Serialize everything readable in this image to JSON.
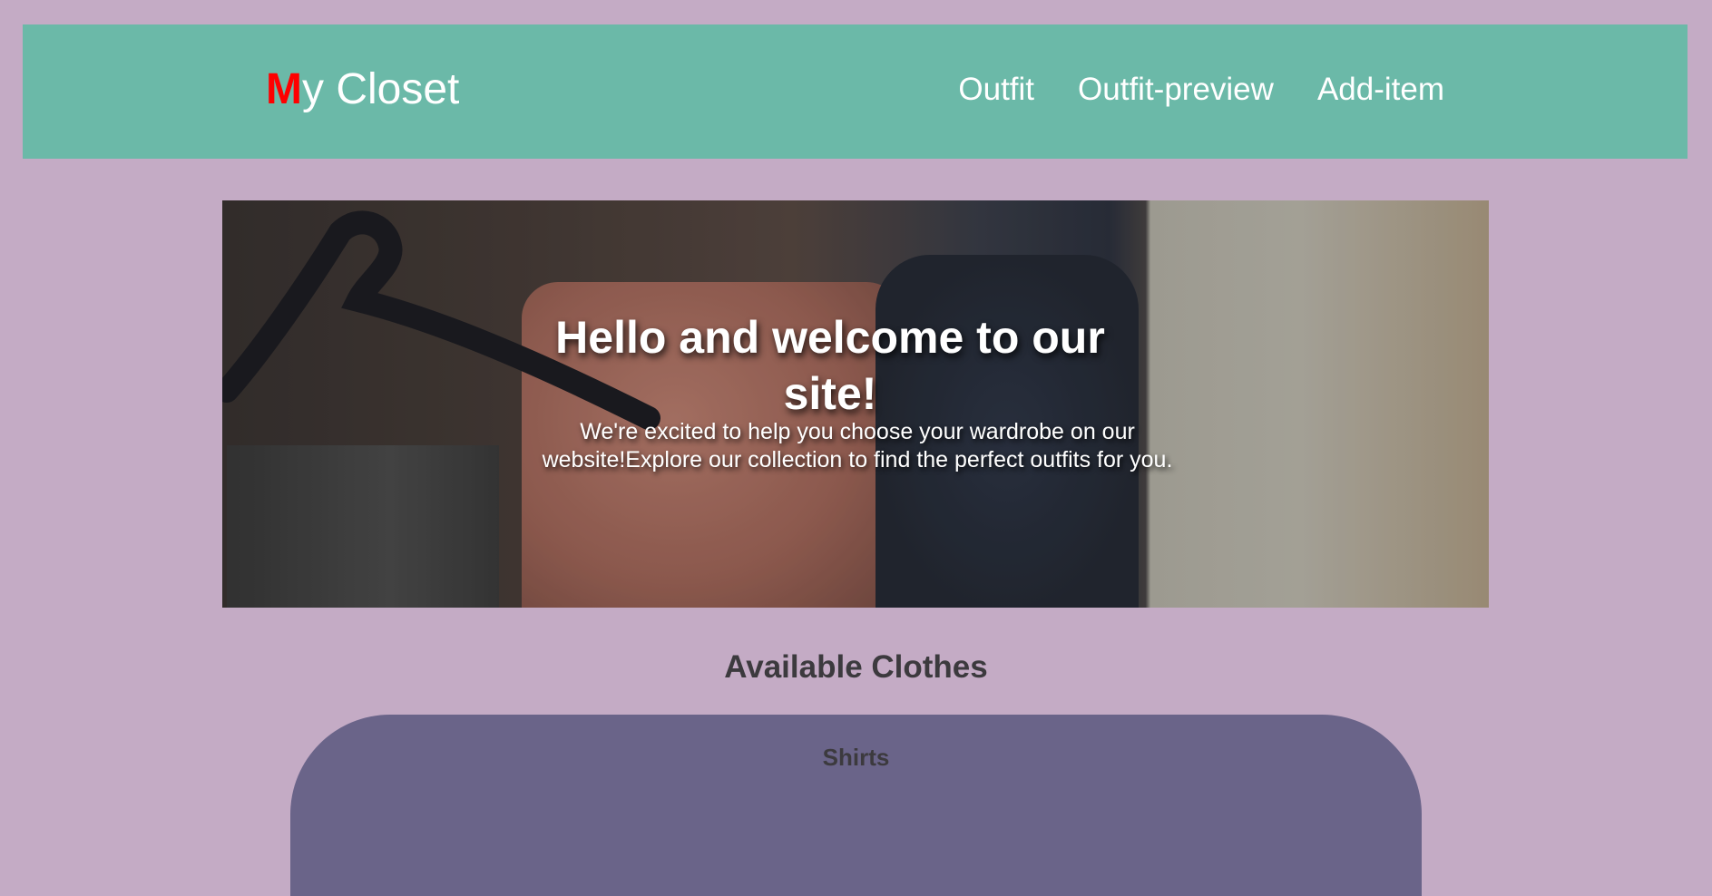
{
  "navbar": {
    "logo_first": "M",
    "logo_rest": "y Closet",
    "links": [
      "Outfit",
      "Outfit-preview",
      "Add-item"
    ]
  },
  "hero": {
    "title": "Hello and welcome to our site!",
    "text": "We're excited to help you choose your wardrobe on our website!Explore our collection to find the perfect outfits for you."
  },
  "section": {
    "title": "Available Clothes",
    "category": "Shirts"
  },
  "colors": {
    "page_bg": "#c4abc5",
    "navbar_bg": "#6bb9a8",
    "logo_accent": "#ff0000",
    "category_bg": "#6a6489"
  }
}
